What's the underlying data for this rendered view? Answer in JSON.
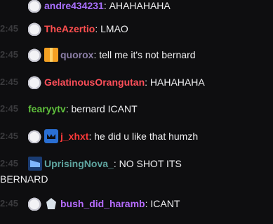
{
  "chat": {
    "messages": [
      {
        "timestamp": "",
        "username": "andre434231",
        "username_color": "#a970ff",
        "text": "AHAHAHAHA",
        "badges": [
          "cat-badge-icon"
        ]
      },
      {
        "timestamp": "2:45",
        "username": "TheAzertio",
        "username_color": "#ff4f4f",
        "text": "LMAO",
        "badges": [
          "cat-badge-icon"
        ]
      },
      {
        "timestamp": "2:45",
        "username": "quorox",
        "username_color": "#8b7ea6",
        "text": "tell me it's not bernard",
        "badges": [
          "cat-badge-icon",
          "gift-badge-icon"
        ]
      },
      {
        "timestamp": "2:45",
        "username": "GelatinousOrangutan",
        "username_color": "#ff4f5a",
        "text": "HAHAHAHA",
        "badges": [
          "cat-badge-icon"
        ]
      },
      {
        "timestamp": "2:45",
        "username": "fearyytv",
        "username_color": "#5fbf3c",
        "text": "bernard ICANT",
        "badges": []
      },
      {
        "timestamp": "2:45",
        "username": "j_xhxt",
        "username_color": "#ff3a3a",
        "text": "he did u like that humzh",
        "badges": [
          "cat-badge-icon",
          "crown-badge-icon"
        ]
      },
      {
        "timestamp": "2:45",
        "username": "UprisingNova_",
        "username_color": "#5fa5a0",
        "text": "NO SHOT ITS",
        "text_line2": "BERNARD",
        "badges": [
          "prime-badge-icon"
        ]
      },
      {
        "timestamp": "2:45",
        "username": "bush_did_haramb",
        "username_color": "#b66cff",
        "text": "ICANT",
        "badges": [
          "cat-badge-icon",
          "gem-badge-icon"
        ]
      }
    ]
  }
}
